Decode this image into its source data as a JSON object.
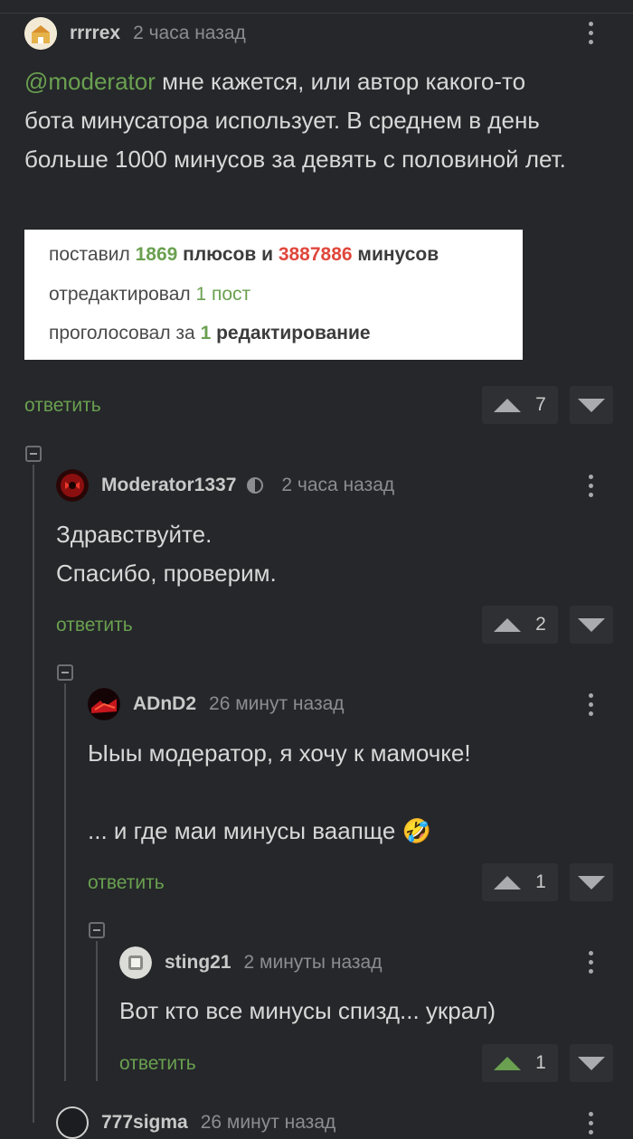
{
  "comments": [
    {
      "author": "rrrrex",
      "time": "2 часа назад",
      "mention": "@moderator",
      "text": " мне кажется, или автор какого-то бота минусатора использует. В среднем в день больше 1000 минусов за девять с половиной лет.",
      "quote": {
        "line1_a": "поставил ",
        "line1_plus": "1869",
        "line1_b": " плюсов и ",
        "line1_minus": "3887886",
        "line1_c": " минусов",
        "line2_a": "отредактировал ",
        "line2_b": "1 пост",
        "line3_a": "проголосовал за ",
        "line3_num": "1",
        "line3_b": " редактирование"
      },
      "reply": "ответить",
      "rating": "7"
    },
    {
      "author": "Moderator1337",
      "time": "2 часа назад",
      "text": "Здравствуйте.\nСпасибо, проверим.",
      "reply": "ответить",
      "rating": "2"
    },
    {
      "author": "ADnD2",
      "time": "26 минут назад",
      "text": "Ыыы модератор, я хочу к мамочке!\n\n... и где маи минусы ваапще 🤣",
      "reply": "ответить",
      "rating": "1"
    },
    {
      "author": "sting21",
      "time": "2 минуты назад",
      "text": "Вот кто все минусы спизд... украл)",
      "reply": "ответить",
      "rating": "1"
    },
    {
      "author": "777sigma",
      "time": "26 минут назад"
    }
  ],
  "colors": {
    "accent_green": "#6aa050",
    "minus_red": "#e0473c",
    "background": "#25272a"
  }
}
